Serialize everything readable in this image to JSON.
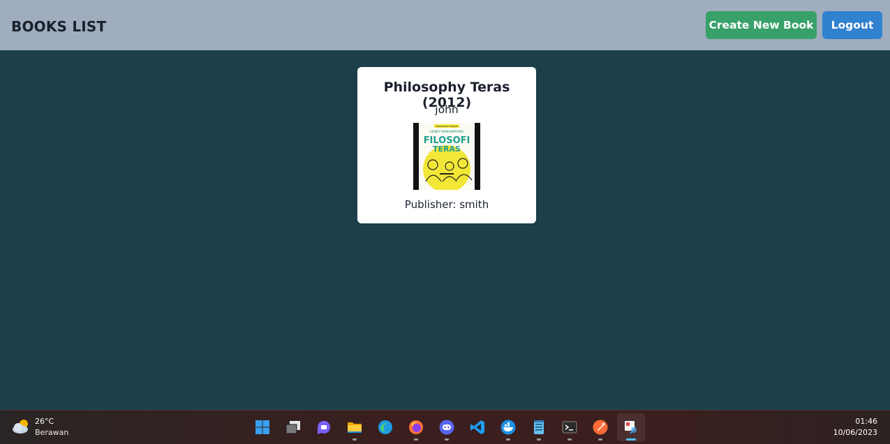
{
  "header": {
    "title": "BOOKS LIST",
    "create_label": "Create New Book",
    "logout_label": "Logout"
  },
  "book": {
    "title": "Philosophy Teras (2012)",
    "author": "john",
    "publisher": "Publisher: smith",
    "cover": {
      "small_top": "FIRMAN BEST SELLER",
      "author": "HENRY MANAMPIRING",
      "line1": "FILOSOFI",
      "line2": "TERAS"
    }
  },
  "taskbar": {
    "weather": {
      "temp": "26°C",
      "condition": "Berawan",
      "icon": "cloud-sun-icon"
    },
    "apps": [
      {
        "name": "start-menu",
        "icon": "windows-icon"
      },
      {
        "name": "task-view",
        "icon": "task-view-icon"
      },
      {
        "name": "teams-chat",
        "icon": "teams-chat-icon"
      },
      {
        "name": "file-explorer",
        "icon": "folder-icon"
      },
      {
        "name": "edge",
        "icon": "edge-icon"
      },
      {
        "name": "firefox",
        "icon": "firefox-icon"
      },
      {
        "name": "discord",
        "icon": "discord-icon"
      },
      {
        "name": "vscode",
        "icon": "vscode-icon"
      },
      {
        "name": "docker",
        "icon": "docker-icon"
      },
      {
        "name": "notepad",
        "icon": "notepad-icon"
      },
      {
        "name": "terminal",
        "icon": "terminal-icon"
      },
      {
        "name": "postman",
        "icon": "postman-icon"
      },
      {
        "name": "snipping-tool",
        "icon": "snipping-tool-icon"
      }
    ],
    "clock": {
      "time": "01:46",
      "date": "10/06/2023"
    }
  },
  "colors": {
    "page_bg": "#1c3f4a",
    "header_bg": "#a0adbe",
    "create_btn": "#38a169",
    "logout_btn": "#3182ce",
    "card_bg": "#ffffff"
  }
}
